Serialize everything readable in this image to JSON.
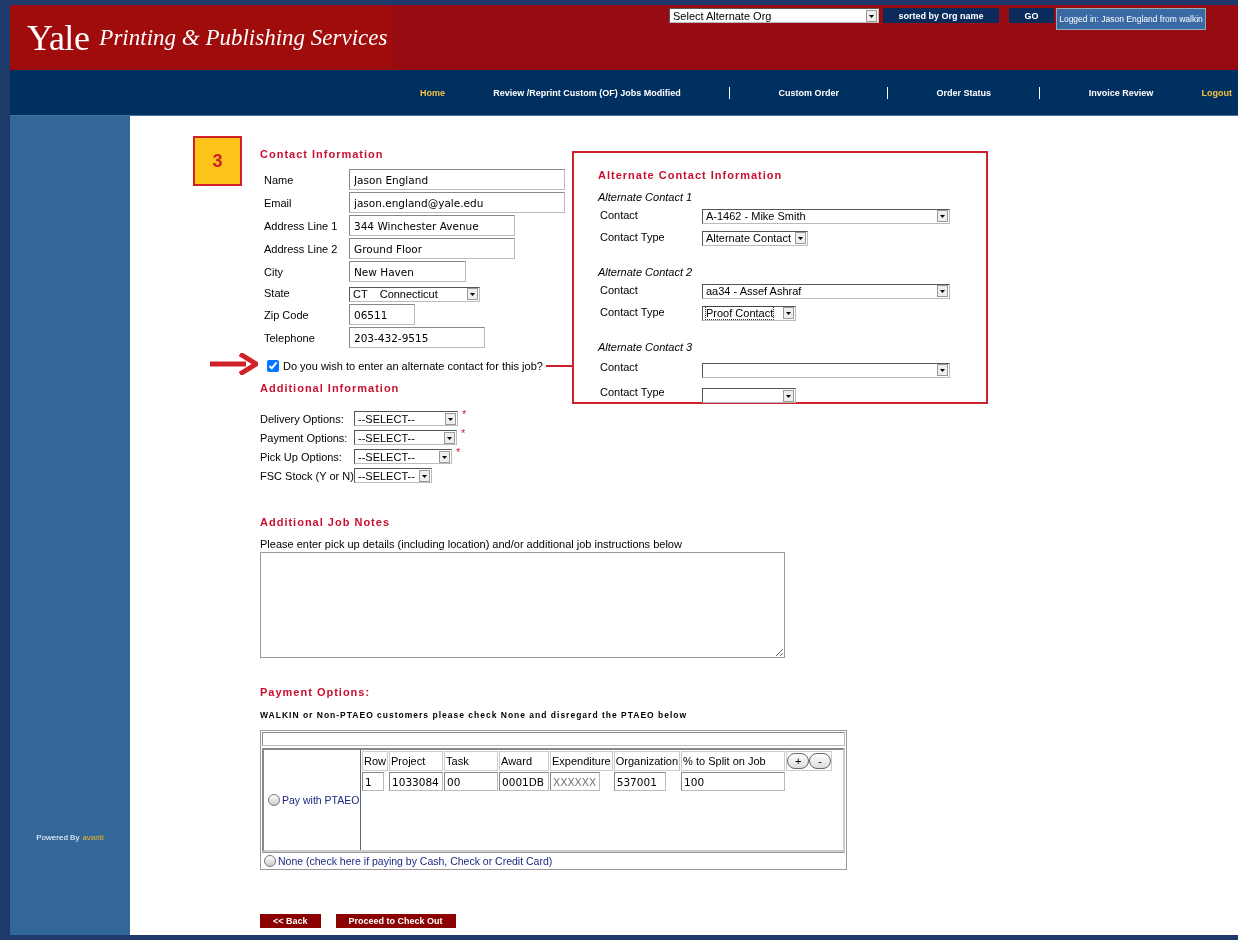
{
  "header": {
    "logo": {
      "word": "Yale",
      "tagline": "Printing & Publishing Services"
    },
    "org_select": {
      "value": "Select Alternate Org"
    },
    "sort_label": "sorted by Org name",
    "go_button": "GO",
    "login_status": "Logged in: Jason England from walkin"
  },
  "nav": [
    {
      "label": "Home",
      "color": "#f5c242",
      "separator_before": false
    },
    {
      "label": "Review /Reprint Custom (OF) Jobs Modified",
      "color": "#ffffff",
      "separator_before": false
    },
    {
      "label": "Custom Order",
      "color": "#ffffff",
      "separator_before": true
    },
    {
      "label": "Order Status",
      "color": "#ffffff",
      "separator_before": true
    },
    {
      "label": "Invoice Review",
      "color": "#ffffff",
      "separator_before": true
    },
    {
      "label": "Logout",
      "color": "#f5c242",
      "separator_before": false
    }
  ],
  "sidebar": {
    "powered_by": "Powered By",
    "brand_link": "avanti"
  },
  "step_badge": "3",
  "contact_information": {
    "title": "Contact Information",
    "fields": [
      {
        "label": "Name",
        "value": "Jason England",
        "kind": "text"
      },
      {
        "label": "Email",
        "value": "jason.england@yale.edu",
        "kind": "text"
      },
      {
        "label": "Address Line 1",
        "value": "344 Winchester Avenue",
        "kind": "text"
      },
      {
        "label": "Address Line 2",
        "value": "Ground Floor",
        "kind": "text"
      },
      {
        "label": "City",
        "value": "New Haven",
        "kind": "text"
      },
      {
        "label": "State",
        "value": "CT    Connecticut",
        "kind": "select"
      },
      {
        "label": "Zip Code",
        "value": "06511",
        "kind": "text"
      },
      {
        "label": "Telephone",
        "value": "203-432-9515",
        "kind": "text"
      }
    ],
    "alternate_question": {
      "label": "Do you wish to enter an alternate contact for this job?",
      "checked": true
    }
  },
  "alternate_contacts": {
    "title": "Alternate Contact Information",
    "groups": [
      {
        "title": "Alternate Contact 1",
        "contact_label": "Contact",
        "contact": "A-1462 - Mike Smith",
        "type_label": "Contact Type",
        "type": "Alternate Contact",
        "focused": false
      },
      {
        "title": "Alternate Contact 2",
        "contact_label": "Contact",
        "contact": "aa34 - Assef Ashraf",
        "type_label": "Contact Type",
        "type": "Proof Contact",
        "focused": true
      },
      {
        "title": "Alternate Contact 3",
        "contact_label": "Contact",
        "type_label": "Contact Type",
        "focused": false
      }
    ]
  },
  "additional_information": {
    "title": "Additional Information",
    "options": [
      {
        "label": "Delivery Options:",
        "value": "--SELECT--",
        "marker": "*"
      },
      {
        "label": "Payment Options:",
        "value": "--SELECT--",
        "marker": "*"
      },
      {
        "label": "Pick Up Options:",
        "value": "--SELECT--",
        "marker": "*"
      },
      {
        "label": "FSC Stock (Y or N)",
        "value": "--SELECT--"
      }
    ]
  },
  "job_notes": {
    "title": "Additional Job Notes",
    "instructions": "Please enter pick up details (including location) and/or additional job instructions below"
  },
  "payment_options": {
    "title": "Payment Options:",
    "notice": "WALKIN or Non-PTAEO customers please check None and disregard the PTAEO below",
    "methods": [
      {
        "label": "Pay with PTAEO",
        "selected": false
      },
      {
        "label": "None (check here if paying by Cash, Check or Credit Card)",
        "selected": false
      }
    ],
    "ptaeo_table": {
      "columns": [
        "Row",
        "Project",
        "Task",
        "Award",
        "Expenditure",
        "Organization",
        "% to Split on Job"
      ],
      "rows": [
        {
          "cells": [
            {
              "value": "1"
            },
            {
              "value": "1033084"
            },
            {
              "value": "00"
            },
            {
              "value": "0001DB"
            },
            {
              "placeholder": "XXXXXX"
            },
            {
              "value": "537001"
            },
            {
              "value": "100"
            }
          ]
        }
      ],
      "add_button": "+",
      "remove_button": "-"
    }
  },
  "buttons": [
    {
      "label": "<< Back"
    },
    {
      "label": "Proceed to Check Out"
    }
  ]
}
